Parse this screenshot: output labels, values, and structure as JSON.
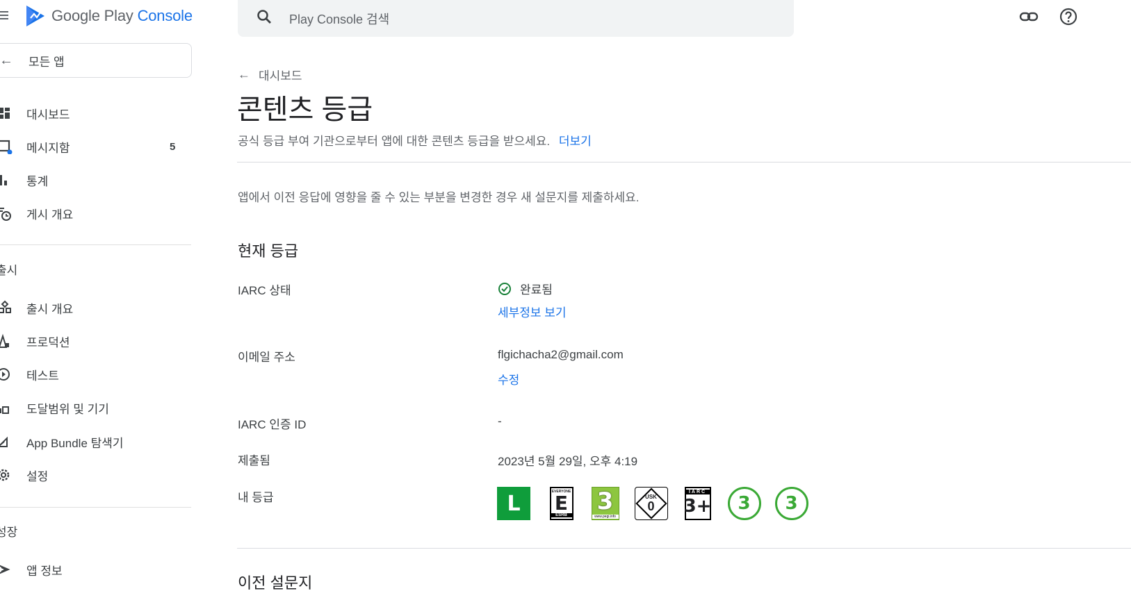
{
  "app": {
    "logo_google_play": "Google Play",
    "logo_console": "Console"
  },
  "search": {
    "placeholder": "Play Console 검색"
  },
  "sidebar": {
    "all_apps": "모든 앱",
    "items": [
      {
        "label": "대시보드",
        "icon": "dashboard-icon"
      },
      {
        "label": "메시지함",
        "icon": "inbox-icon",
        "badge": "5"
      },
      {
        "label": "통계",
        "icon": "bar-chart-icon"
      },
      {
        "label": "게시 개요",
        "icon": "publishing-overview-icon"
      }
    ],
    "section_release": "출시",
    "release_items": [
      {
        "label": "출시 개요",
        "icon": "release-overview-icon"
      },
      {
        "label": "프로덕션",
        "icon": "production-icon"
      },
      {
        "label": "테스트",
        "icon": "testing-icon"
      },
      {
        "label": "도달범위 및 기기",
        "icon": "devices-icon"
      },
      {
        "label": "App Bundle 탐색기",
        "icon": "app-bundle-icon"
      },
      {
        "label": "설정",
        "icon": "settings-icon"
      }
    ],
    "section_grow": "성장",
    "grow_items": [
      {
        "label": "앱 정보",
        "icon": "store-presence-icon"
      }
    ]
  },
  "main": {
    "back_label": "대시보드",
    "title": "콘텐츠 등급",
    "subtitle": "공식 등급 부여 기관으로부터 앱에 대한 콘텐츠 등급을 받으세요.",
    "learn_more": "더보기",
    "info": "앱에서 이전 응답에 영향을 줄 수 있는 부분을 변경한 경우 새 설문지를 제출하세요.",
    "current_rating_heading": "현재 등급",
    "iarc_status_label": "IARC 상태",
    "iarc_status_value": "완료됨",
    "view_details": "세부정보 보기",
    "email_label": "이메일 주소",
    "email_value": "flgichacha2@gmail.com",
    "edit": "수정",
    "iarc_id_label": "IARC 인증 ID",
    "iarc_id_value": "-",
    "submitted_label": "제출됨",
    "submitted_value": "2023년 5월 29일, 오후 4:19",
    "my_rating_label": "내 등급",
    "previous_heading": "이전 설문지"
  },
  "ratings": {
    "classind": "L",
    "esrb_top": "EVERYONE",
    "esrb_letter": "E",
    "esrb_bottom": "ESRB",
    "pegi_number": "3",
    "pegi_url": "www.pegi.info",
    "usk_label": "USK",
    "usk_number": "0",
    "iarc_header": "IARC",
    "iarc_rating": "3+",
    "circle_1": "3",
    "circle_2": "3"
  },
  "colors": {
    "accent": "#1a73e8",
    "success": "#188038",
    "classind_green": "#0f9d3b",
    "pegi_green": "#8dc63f",
    "circle_green": "#3aa935"
  }
}
